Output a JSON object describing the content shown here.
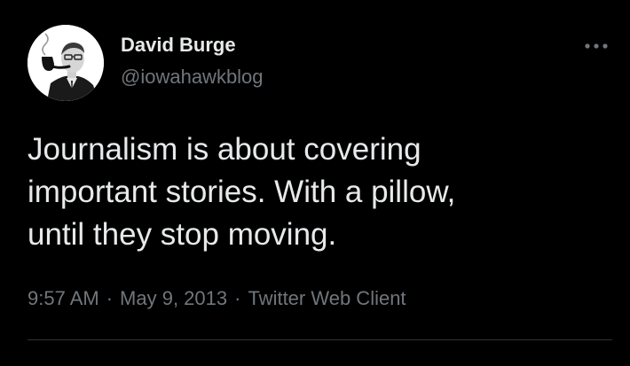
{
  "author": {
    "display_name": "David Burge",
    "handle": "@iowahawkblog",
    "avatar_icon": "portrait-with-pipe-avatar"
  },
  "tweet": {
    "text": "Journalism is about covering\nimportant stories. With a pillow,\nuntil they stop moving.",
    "time": "9:57 AM",
    "date": "May 9, 2013",
    "source": "Twitter Web Client",
    "separator": "·"
  },
  "menu": {
    "icon": "more-options-icon"
  },
  "colors": {
    "background": "#000000",
    "primary_text": "#e7e9ea",
    "secondary_text": "#71767b",
    "divider": "#2f3336"
  }
}
